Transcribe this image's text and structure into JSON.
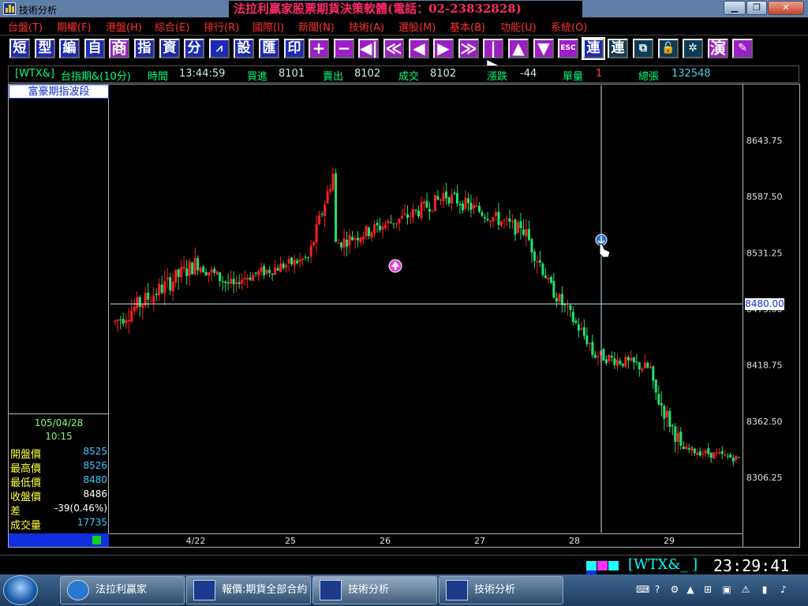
{
  "window": {
    "title": "技術分析",
    "banner": "法拉利贏家股票期貨決策軟體(電話：02-23832828)"
  },
  "menu": [
    "台盤(T)",
    "期權(F)",
    "港盤(H)",
    "綜合(E)",
    "排行(R)",
    "國際(I)",
    "新聞(N)",
    "技術(A)",
    "選股(M)",
    "基本(B)",
    "功能(U)",
    "系統(O)"
  ],
  "toolbar": [
    {
      "label": "短",
      "style": "blue"
    },
    {
      "label": "型",
      "style": "blue"
    },
    {
      "label": "編",
      "style": "blue"
    },
    {
      "label": "自",
      "style": "blue"
    },
    {
      "label": "商",
      "style": "purple"
    },
    {
      "label": "指",
      "style": "blue"
    },
    {
      "label": "資",
      "style": "blue"
    },
    {
      "label": "分",
      "style": "blue"
    },
    {
      "label": "chart-icon",
      "style": "blue"
    },
    {
      "label": "設",
      "style": "blue"
    },
    {
      "label": "匯",
      "style": "blue"
    },
    {
      "label": "印",
      "style": "blue"
    },
    {
      "label": "+",
      "style": "purple"
    },
    {
      "label": "−",
      "style": "purple"
    },
    {
      "label": "◀|",
      "style": "purple"
    },
    {
      "label": "≪",
      "style": "purple"
    },
    {
      "label": "◀",
      "style": "purple"
    },
    {
      "label": "▶",
      "style": "purple"
    },
    {
      "label": "≫",
      "style": "purple"
    },
    {
      "label": "|▶",
      "style": "purple"
    },
    {
      "label": "▲",
      "style": "purple"
    },
    {
      "label": "▼",
      "style": "purple"
    },
    {
      "label": "ESC",
      "style": "purple"
    },
    {
      "label": "連",
      "style": "blue"
    },
    {
      "label": "連",
      "style": "dark"
    },
    {
      "label": "window-icon",
      "style": "dark"
    },
    {
      "label": "lock-icon",
      "style": "dark"
    },
    {
      "label": "fan-icon",
      "style": "dark"
    },
    {
      "label": "演",
      "style": "purple"
    },
    {
      "label": "edit-icon",
      "style": "purple"
    }
  ],
  "quote": {
    "symbol": "[WTX&]",
    "name": "台指期&(10分)",
    "time_label": "時間",
    "time": "13:44:59",
    "bid_label": "買進",
    "bid": "8101",
    "ask_label": "賣出",
    "ask": "8102",
    "last_label": "成交",
    "last": "8102",
    "change_label": "漲跌",
    "change": "-44",
    "vol_label": "單量",
    "vol": "1",
    "total_label": "總張",
    "total": "132548"
  },
  "panel": {
    "title": "富豪期指波段",
    "date": "105/04/28",
    "time": "10:15",
    "rows": [
      {
        "label": "開盤價",
        "value": "8525",
        "color": "#40c8ff"
      },
      {
        "label": "最高價",
        "value": "8526",
        "color": "#40c8ff"
      },
      {
        "label": "最低價",
        "value": "8480",
        "color": "#40c8ff"
      },
      {
        "label": "收盤價",
        "value": "8486",
        "color": "#ffffff"
      },
      {
        "label": "差",
        "value": "-39(0.46%)",
        "color": "#ffffff"
      },
      {
        "label": "成交量",
        "value": "17735",
        "color": "#40c8ff"
      }
    ]
  },
  "chart_data": {
    "type": "candlestick",
    "y_ticks": [
      8643.75,
      8587.5,
      8531.25,
      8475.0,
      8418.75,
      8362.5,
      8306.25
    ],
    "x_labels": [
      "4/22",
      "25",
      "26",
      "27",
      "28",
      "29"
    ],
    "crosshair_price": "8480.00",
    "series": [
      {
        "bars": 30,
        "start": 8462,
        "end": 8520,
        "noise": 18
      },
      {
        "bars": 15,
        "start": 8520,
        "end": 8495,
        "noise": 14
      },
      {
        "bars": 25,
        "start": 8505,
        "end": 8525,
        "noise": 12
      },
      {
        "bars": 10,
        "start": 8525,
        "end": 8610,
        "noise": 16
      },
      {
        "bars": 24,
        "start": 8540,
        "end": 8565,
        "noise": 14
      },
      {
        "bars": 15,
        "start": 8565,
        "end": 8585,
        "noise": 14
      },
      {
        "bars": 28,
        "start": 8590,
        "end": 8555,
        "noise": 14
      },
      {
        "bars": 10,
        "start": 8560,
        "end": 8510,
        "noise": 18
      },
      {
        "bars": 16,
        "start": 8500,
        "end": 8440,
        "noise": 14
      },
      {
        "bars": 22,
        "start": 8430,
        "end": 8415,
        "noise": 12
      },
      {
        "bars": 10,
        "start": 8395,
        "end": 8345,
        "noise": 18
      },
      {
        "bars": 22,
        "start": 8335,
        "end": 8325,
        "noise": 8
      }
    ]
  },
  "ticker": {
    "code": "[WTX&_ ]",
    "time": "23:29:41"
  },
  "taskbar": [
    {
      "label": "法拉利贏家",
      "icon": "app-round-icon"
    },
    {
      "label": "報價:期貨全部合約",
      "icon": "chart-app-icon"
    },
    {
      "label": "技術分析",
      "icon": "chart-app-icon",
      "active": true
    },
    {
      "label": "技術分析",
      "icon": "chart-app-icon"
    }
  ]
}
